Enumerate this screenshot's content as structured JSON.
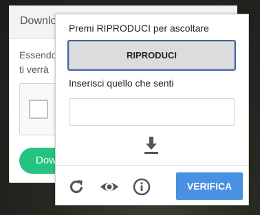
{
  "background_dialog": {
    "title": "Downlo",
    "body_line1": "Essendo",
    "body_line2": "ti verrà",
    "download_button_label": "Dow"
  },
  "captcha": {
    "instruction": "Premi RIPRODUCI per ascoltare",
    "play_button_label": "RIPRODUCI",
    "enter_label": "Inserisci quello che senti",
    "response_value": "",
    "verify_button_label": "VERIFICA",
    "icons": [
      "download-icon",
      "reload-icon",
      "eye-icon",
      "info-icon"
    ]
  },
  "colors": {
    "verify_button": "#4a90e2",
    "play_border": "#3c66a8",
    "download_button": "#26c281",
    "icon_gray": "#555555"
  }
}
